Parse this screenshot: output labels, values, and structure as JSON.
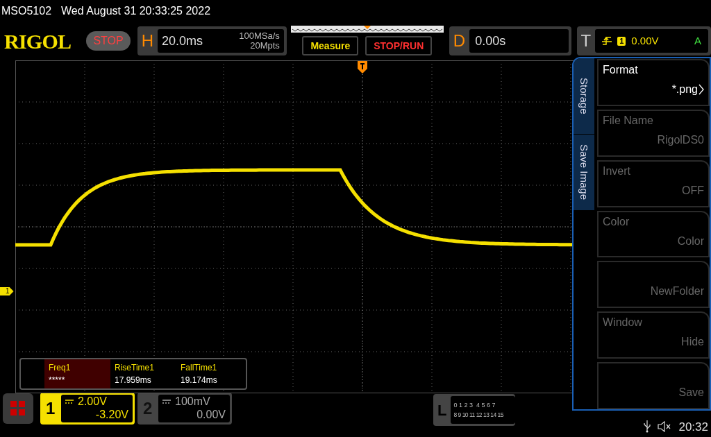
{
  "header": {
    "model": "MSO5102",
    "datetime": "Wed August 31 20:33:25 2022"
  },
  "brand": "RIGOL",
  "run_state": "STOP",
  "horizontal": {
    "label": "H",
    "timebase": "20.0ms",
    "sample_rate": "100MSa/s",
    "memory_depth": "20Mpts"
  },
  "buttons": [
    {
      "label": "Measure",
      "kind": "measure"
    },
    {
      "label": "STOP/RUN",
      "kind": "stoprun"
    }
  ],
  "delay": {
    "label": "D",
    "value": "0.00s"
  },
  "trigger": {
    "label": "T",
    "source": "1",
    "level": "0.00V",
    "mode": "A"
  },
  "channel_marker": "1",
  "menu": {
    "tabs": [
      "Storage",
      "Save Image"
    ],
    "items": [
      {
        "label": "Format",
        "value": "*.png",
        "disabled": false,
        "submenu": true
      },
      {
        "label": "File Name",
        "value": "RigolDS0",
        "disabled": true,
        "submenu": false
      },
      {
        "label": "Invert",
        "value": "OFF",
        "disabled": true,
        "submenu": false
      },
      {
        "label": "Color",
        "value": "Color",
        "disabled": true,
        "submenu": false
      },
      {
        "value": "NewFolder",
        "disabled": true,
        "submenu": false
      },
      {
        "label": "Window",
        "value": "Hide",
        "disabled": true,
        "submenu": false
      },
      {
        "value": "Save",
        "disabled": true,
        "submenu": false
      }
    ]
  },
  "measurements": [
    {
      "name": "Freq1",
      "value": "*****",
      "selected": true
    },
    {
      "name": "RiseTime1",
      "value": "17.959ms",
      "selected": false
    },
    {
      "name": "FallTime1",
      "value": "19.174ms",
      "selected": false
    }
  ],
  "channels": [
    {
      "number": "1",
      "scale": "2.00V",
      "offset": "-3.20V",
      "active": true
    },
    {
      "number": "2",
      "scale": "100mV",
      "offset": "0.00V",
      "active": false
    }
  ],
  "logic": {
    "label": "L",
    "row_1": "0 1 2 3  4 5 6 7",
    "row_2": "8 9 10 11 12 13 14 15"
  },
  "status": {
    "time": "20:32"
  }
}
